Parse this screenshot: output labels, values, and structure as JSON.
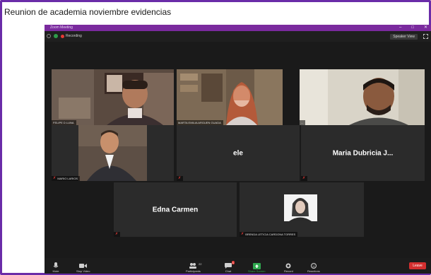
{
  "document": {
    "title": "Reunion de academia noviembre  evidencias"
  },
  "window": {
    "title": "Zoom Meeting",
    "recording_label": "Recording",
    "view_button": "Speaker View"
  },
  "participants": [
    {
      "name": "FELIPE D LUNA",
      "muted": false
    },
    {
      "name": "MARTA EMILIA ARGUEN GUADA",
      "muted": false
    },
    {
      "name": "...",
      "muted": false
    },
    {
      "name": "MARIO LARIOS",
      "muted": true
    },
    {
      "name": "ele",
      "muted": true
    },
    {
      "name": "Maria Dubricia J...",
      "muted": true
    },
    {
      "name": "Edna Carmen",
      "muted": true
    },
    {
      "name": "BRENDA LETICIA CARDONA TORRES",
      "muted": true
    }
  ],
  "toolbar": {
    "mute": "Mute",
    "stop_video": "Stop Video",
    "participants": "Participants",
    "participants_count": "22",
    "chat": "Chat",
    "chat_badge": "1",
    "share_screen": "Share Screen",
    "record": "Record",
    "reactions": "Reactions",
    "end": "Leave"
  },
  "colors": {
    "frame": "#6a2ca8",
    "titlebar": "#7a2a9e",
    "active_speaker": "#8bd34a",
    "end_button": "#d32f2f"
  }
}
